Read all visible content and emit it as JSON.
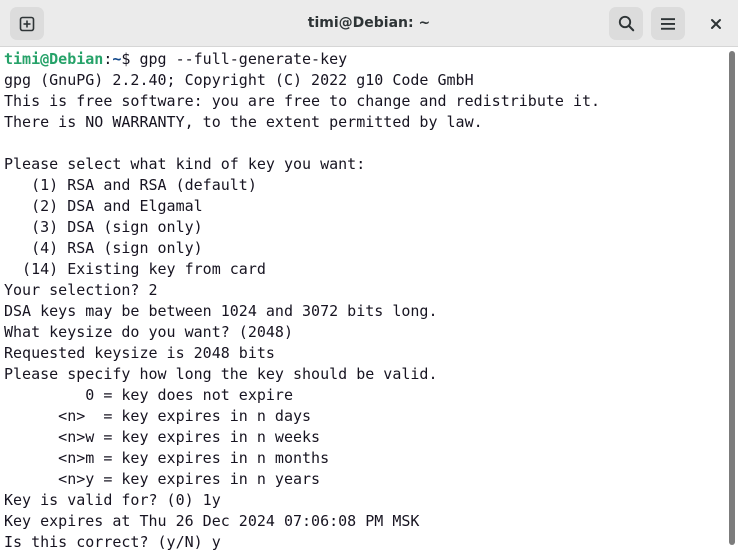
{
  "window": {
    "title": "timi@Debian: ~"
  },
  "titlebar": {
    "new_tab_icon": "plus-square-icon",
    "search_icon": "search-icon",
    "menu_icon": "hamburger-menu-icon",
    "close_icon": "close-icon"
  },
  "terminal": {
    "prompt": {
      "user_host": "timi@Debian",
      "separator": ":",
      "dir": "~",
      "symbol": "$ ",
      "command": "gpg --full-generate-key"
    },
    "lines": [
      "gpg (GnuPG) 2.2.40; Copyright (C) 2022 g10 Code GmbH",
      "This is free software: you are free to change and redistribute it.",
      "There is NO WARRANTY, to the extent permitted by law.",
      "",
      "Please select what kind of key you want:",
      "   (1) RSA and RSA (default)",
      "   (2) DSA and Elgamal",
      "   (3) DSA (sign only)",
      "   (4) RSA (sign only)",
      "  (14) Existing key from card",
      "Your selection? 2",
      "DSA keys may be between 1024 and 3072 bits long.",
      "What keysize do you want? (2048)",
      "Requested keysize is 2048 bits",
      "Please specify how long the key should be valid.",
      "         0 = key does not expire",
      "      <n>  = key expires in n days",
      "      <n>w = key expires in n weeks",
      "      <n>m = key expires in n months",
      "      <n>y = key expires in n years",
      "Key is valid for? (0) 1y",
      "Key expires at Thu 26 Dec 2024 07:06:08 PM MSK",
      "Is this correct? (y/N) y"
    ]
  },
  "colors": {
    "titlebar_bg": "#ebebeb",
    "button_bg": "#dcdcdc",
    "prompt_user": "#26a269",
    "prompt_dir": "#12488b",
    "text": "#171421"
  }
}
